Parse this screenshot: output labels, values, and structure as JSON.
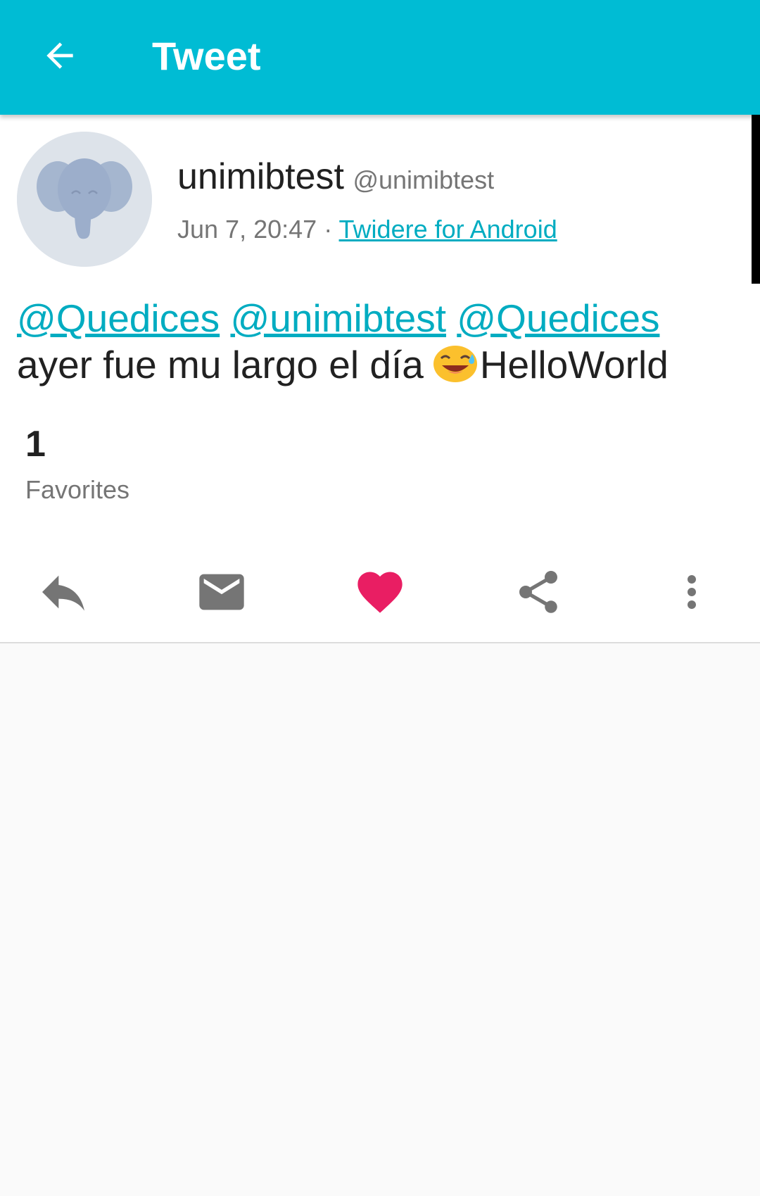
{
  "app_bar": {
    "title": "Tweet",
    "color": "#00bcd4",
    "back_icon": "arrow-back-icon"
  },
  "status": {
    "display_name": "unimibtest",
    "screen_name": "@unimibtest",
    "time": "Jun 7, 20:47",
    "separator": "·",
    "source": "Twidere for Android",
    "mentions": [
      "@Quedices",
      "@unimibtest",
      "@Quedices"
    ],
    "text_before_emoji": "ayer fue mu largo el día",
    "emoji": "smiling-face-with-sweat-icon",
    "text_after_emoji": "HelloWorld",
    "link_color": "#00acc1"
  },
  "stats": {
    "favorites_count": "1",
    "favorites_label": "Favorites"
  },
  "actions": [
    {
      "name": "reply",
      "icon": "reply-icon"
    },
    {
      "name": "message",
      "icon": "mail-icon"
    },
    {
      "name": "favorite",
      "icon": "heart-icon",
      "active_color": "#e91e63"
    },
    {
      "name": "share",
      "icon": "share-icon"
    },
    {
      "name": "more",
      "icon": "more-vert-icon"
    }
  ]
}
